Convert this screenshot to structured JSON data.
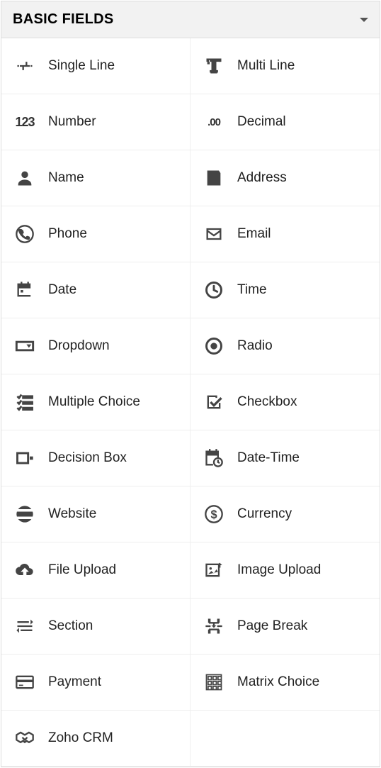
{
  "panel": {
    "title": "BASIC FIELDS",
    "fields": [
      {
        "id": "single-line",
        "label": "Single Line"
      },
      {
        "id": "multi-line",
        "label": "Multi Line"
      },
      {
        "id": "number",
        "label": "Number"
      },
      {
        "id": "decimal",
        "label": "Decimal"
      },
      {
        "id": "name",
        "label": "Name"
      },
      {
        "id": "address",
        "label": "Address"
      },
      {
        "id": "phone",
        "label": "Phone"
      },
      {
        "id": "email",
        "label": "Email"
      },
      {
        "id": "date",
        "label": "Date"
      },
      {
        "id": "time",
        "label": "Time"
      },
      {
        "id": "dropdown",
        "label": "Dropdown"
      },
      {
        "id": "radio",
        "label": "Radio"
      },
      {
        "id": "multiple-choice",
        "label": "Multiple Choice"
      },
      {
        "id": "checkbox",
        "label": "Checkbox"
      },
      {
        "id": "decision-box",
        "label": "Decision Box"
      },
      {
        "id": "date-time",
        "label": "Date-Time"
      },
      {
        "id": "website",
        "label": "Website"
      },
      {
        "id": "currency",
        "label": "Currency"
      },
      {
        "id": "file-upload",
        "label": "File Upload"
      },
      {
        "id": "image-upload",
        "label": "Image Upload"
      },
      {
        "id": "section",
        "label": "Section"
      },
      {
        "id": "page-break",
        "label": "Page Break"
      },
      {
        "id": "payment",
        "label": "Payment"
      },
      {
        "id": "matrix-choice",
        "label": "Matrix Choice"
      },
      {
        "id": "zoho-crm",
        "label": "Zoho CRM"
      }
    ]
  }
}
